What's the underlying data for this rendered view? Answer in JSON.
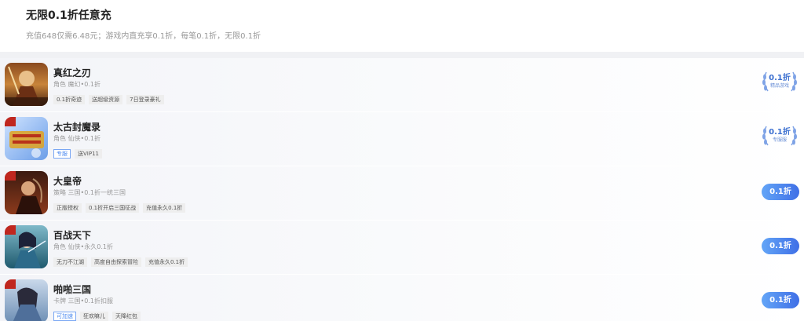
{
  "header": {
    "title": "无限0.1折任意充",
    "subtitle": "充值648仅需6.48元；游戏内直充享0.1折，每笔0.1折，无限0.1折"
  },
  "games": [
    {
      "name": "真红之刃",
      "meta": "角色 魔幻•0.1折",
      "tags": [
        {
          "label": "0.1折奇迹",
          "style": "gray"
        },
        {
          "label": "送超级资源",
          "style": "gray"
        },
        {
          "label": "7日登录豪礼",
          "style": "gray"
        }
      ],
      "action": {
        "type": "badge",
        "main": "0.1折",
        "sub": "精品游戏"
      }
    },
    {
      "name": "太古封魔录",
      "meta": "角色 仙侠•0.1折",
      "tags": [
        {
          "label": "专服",
          "style": "blue"
        },
        {
          "label": "送VIP11",
          "style": "gray"
        }
      ],
      "action": {
        "type": "badge",
        "main": "0.1折",
        "sub": "专服服"
      }
    },
    {
      "name": "大皇帝",
      "meta": "策略 三国•0.1折一统三国",
      "tags": [
        {
          "label": "正版授权",
          "style": "gray"
        },
        {
          "label": "0.1折开启三国征战",
          "style": "gray"
        },
        {
          "label": "充值永久0.1折",
          "style": "gray"
        }
      ],
      "action": {
        "type": "pill",
        "main": "0.1折"
      }
    },
    {
      "name": "百战天下",
      "meta": "角色 仙侠•永久0.1折",
      "tags": [
        {
          "label": "无刀不江湖",
          "style": "gray"
        },
        {
          "label": "高度自由探索冒险",
          "style": "gray"
        },
        {
          "label": "充值永久0.1折",
          "style": "gray"
        }
      ],
      "action": {
        "type": "pill",
        "main": "0.1折"
      }
    },
    {
      "name": "啪啪三国",
      "meta": "卡牌 三国•0.1折扣服",
      "tags": [
        {
          "label": "可加速",
          "style": "blue"
        },
        {
          "label": "狂欢嘛儿",
          "style": "gray"
        },
        {
          "label": "天降红包",
          "style": "gray"
        }
      ],
      "action": {
        "type": "pill",
        "main": "0.1折"
      }
    }
  ]
}
